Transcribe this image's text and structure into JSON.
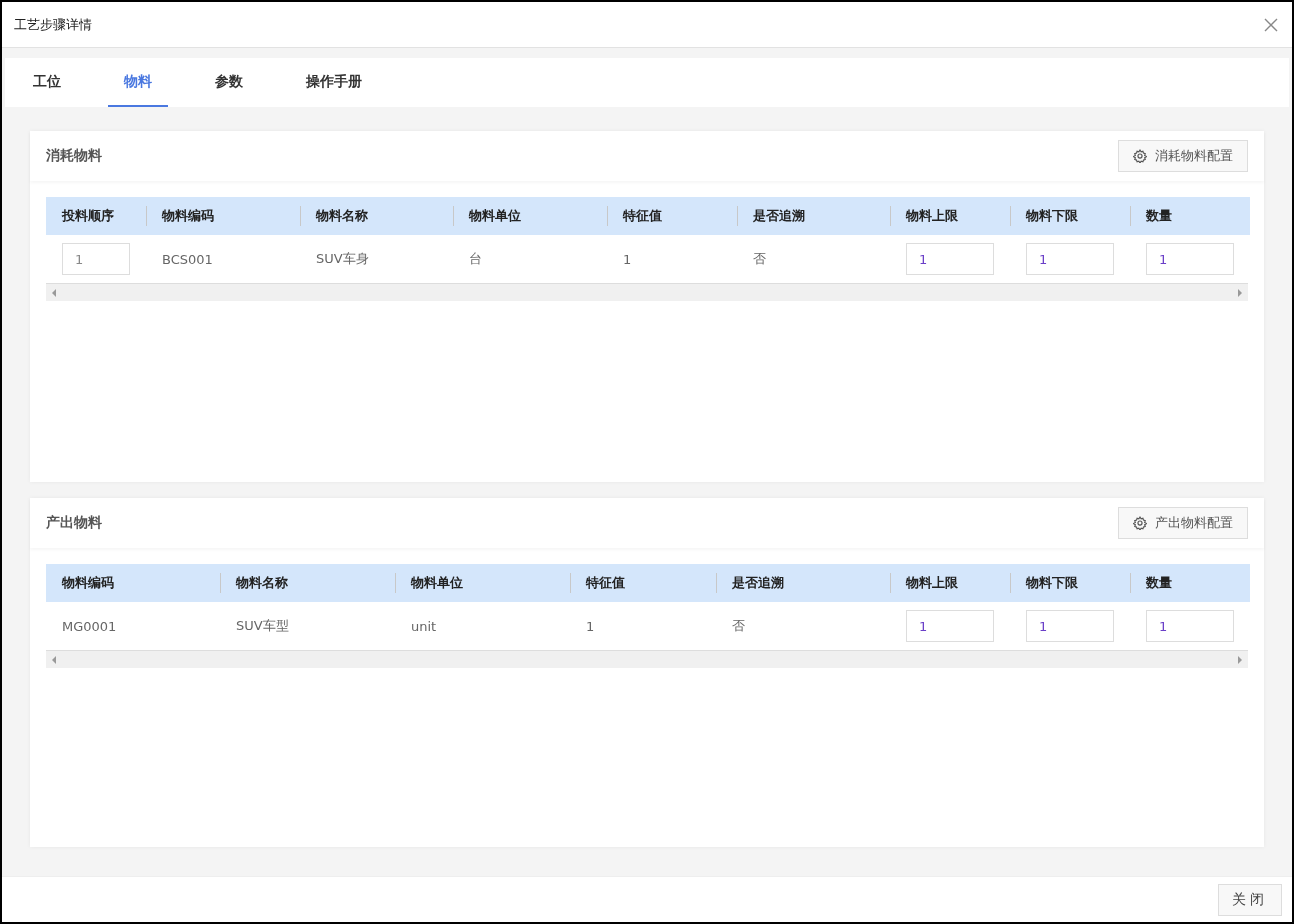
{
  "dialog": {
    "title": "工艺步骤详情"
  },
  "tabs": [
    {
      "label": "工位",
      "selected": false
    },
    {
      "label": "物料",
      "selected": true
    },
    {
      "label": "参数",
      "selected": false
    },
    {
      "label": "操作手册",
      "selected": false
    }
  ],
  "sections": [
    {
      "title": "消耗物料",
      "button": "消耗物料配置",
      "table": {
        "columns": [
          "投料顺序",
          "物料编码",
          "物料名称",
          "物料单位",
          "特征值",
          "是否追溯",
          "物料上限",
          "物料下限",
          "数量"
        ],
        "rows": [
          [
            {
              "kind": "input",
              "value": "1"
            },
            {
              "kind": "text",
              "value": "BCS001"
            },
            {
              "kind": "text",
              "value": "SUV车身"
            },
            {
              "kind": "text",
              "value": "台"
            },
            {
              "kind": "text",
              "value": "1"
            },
            {
              "kind": "text",
              "value": "否"
            },
            {
              "kind": "limit",
              "value": "1"
            },
            {
              "kind": "limit",
              "value": "1"
            },
            {
              "kind": "limit",
              "value": "1"
            }
          ]
        ]
      }
    },
    {
      "title": "产出物料",
      "button": "产出物料配置",
      "table": {
        "columns": [
          "物料编码",
          "物料名称",
          "物料单位",
          "特征值",
          "是否追溯",
          "物料上限",
          "物料下限",
          "数量"
        ],
        "rows": [
          [
            {
              "kind": "text",
              "value": "MG0001"
            },
            {
              "kind": "text",
              "value": "SUV车型"
            },
            {
              "kind": "text",
              "value": "unit"
            },
            {
              "kind": "text",
              "value": "1"
            },
            {
              "kind": "text",
              "value": "否"
            },
            {
              "kind": "limit",
              "value": "1"
            },
            {
              "kind": "limit",
              "value": "1"
            },
            {
              "kind": "limit",
              "value": "1"
            }
          ]
        ]
      }
    }
  ],
  "footer": {
    "button": "关闭"
  }
}
